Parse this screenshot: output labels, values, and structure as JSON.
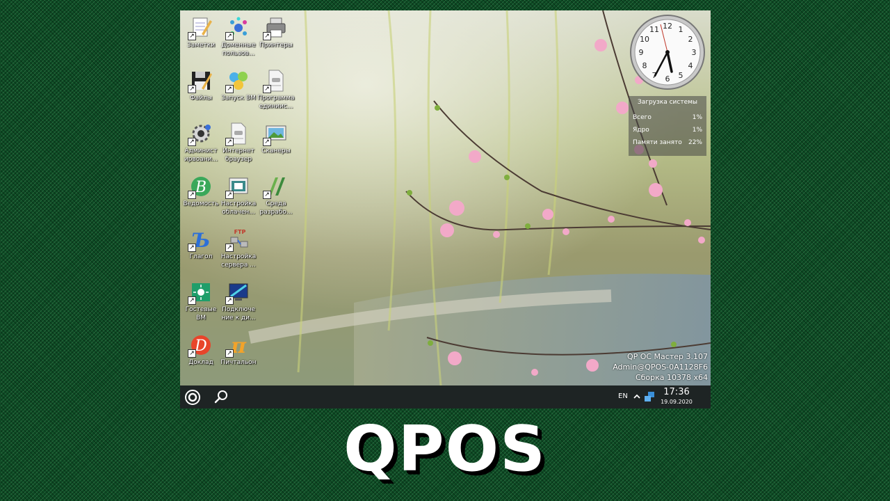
{
  "desktop": {
    "icons": [
      {
        "id": "notes",
        "label": "Заметки"
      },
      {
        "id": "domain-users",
        "label": "Доменные пользов..."
      },
      {
        "id": "printers",
        "label": "Принтеры"
      },
      {
        "id": "files",
        "label": "Файлы"
      },
      {
        "id": "launch-vm",
        "label": "Запуск ВМ"
      },
      {
        "id": "admin-program",
        "label": "Программа единиис..."
      },
      {
        "id": "administration",
        "label": "Админист ирвоани..."
      },
      {
        "id": "browser",
        "label": "Интернет браузер"
      },
      {
        "id": "scanners",
        "label": "Сканеры"
      },
      {
        "id": "vedomost",
        "label": "Ведомость"
      },
      {
        "id": "cloud-settings",
        "label": "Настройка облачен..."
      },
      {
        "id": "dev-env",
        "label": "Среда разрабо..."
      },
      {
        "id": "glagol",
        "label": "Глагол"
      },
      {
        "id": "ftp-settings",
        "label": "Настройка сервера ..."
      },
      {
        "id": "guest-vm",
        "label": "Гостевые ВМ"
      },
      {
        "id": "remote-connect",
        "label": "Подключе ние к ди..."
      },
      {
        "id": "doklad",
        "label": "Доклад"
      },
      {
        "id": "pi-calc",
        "label": "Пичтальон"
      }
    ]
  },
  "system_load": {
    "title": "Загрузка системы",
    "rows": [
      {
        "label": "Всего",
        "value": "1%"
      },
      {
        "label": "Ядро",
        "value": "1%"
      },
      {
        "label": "Памяти занято",
        "value": "22%"
      }
    ]
  },
  "os_info": {
    "line1": "QP ОС Мастер 3.107",
    "line2": "Admin@QPOS-0A1128F6",
    "line3": "Сборка 10378 x64"
  },
  "taskbar": {
    "language": "EN",
    "time": "17:36",
    "date": "19.09.2020"
  },
  "clock_face": {
    "numbers": [
      "12",
      "1",
      "2",
      "3",
      "4",
      "5",
      "6",
      "7",
      "8",
      "9",
      "10",
      "11"
    ]
  },
  "caption": {
    "brand": "QPOS"
  },
  "colors": {
    "taskbar": "#1e2424",
    "frame_green": "#0d4a24",
    "blossom": "#f2a9c8"
  }
}
